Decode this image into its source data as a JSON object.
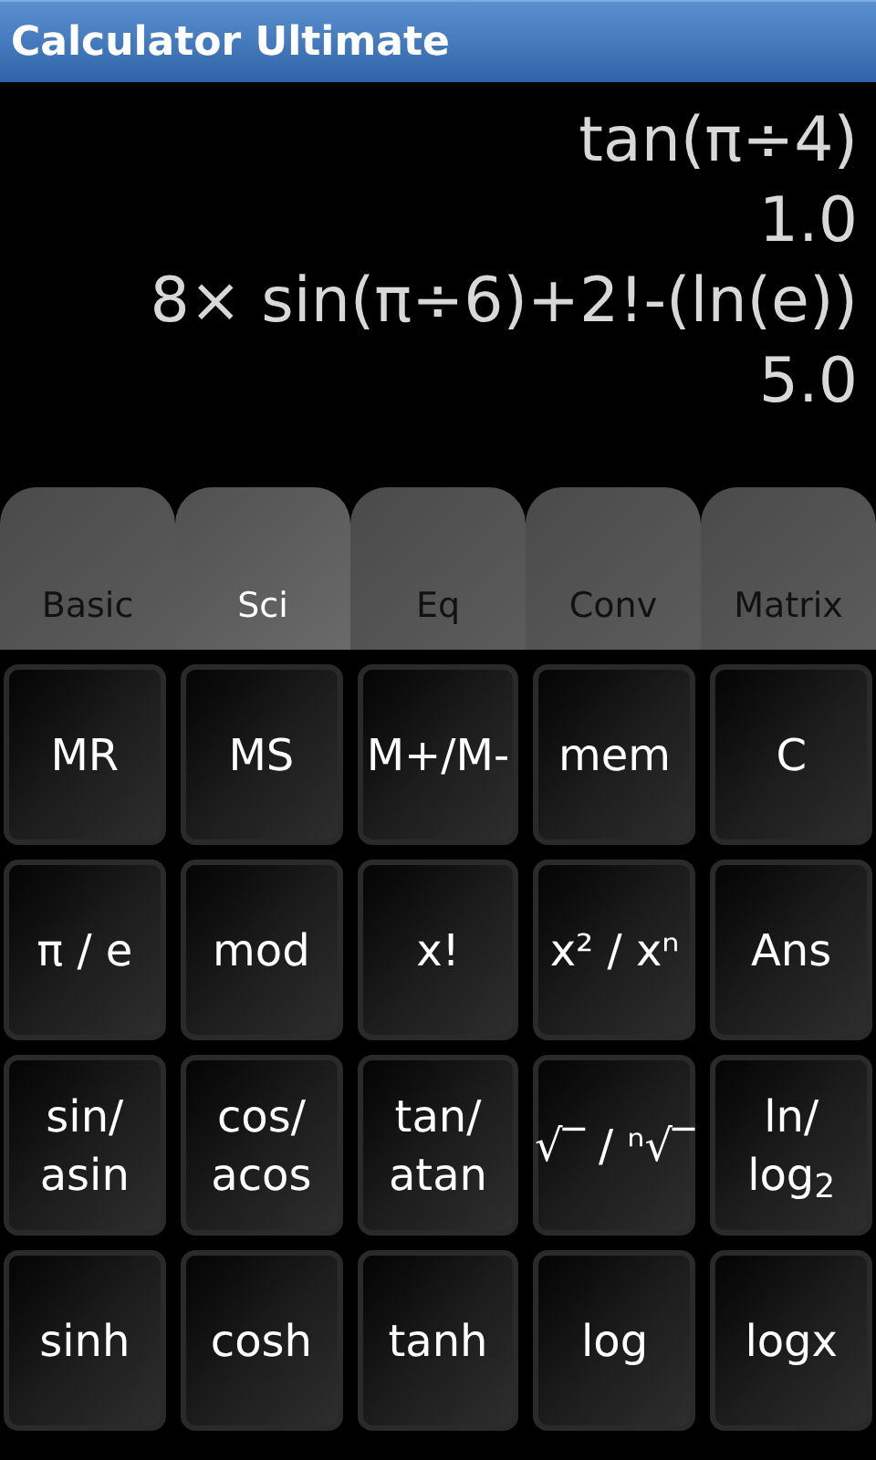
{
  "window": {
    "title": "Calculator Ultimate"
  },
  "display": {
    "lines": [
      "tan(π÷4)",
      "1.0",
      "8× sin(π÷6)+2!-(ln(e))",
      "5.0"
    ]
  },
  "tabs": [
    {
      "label": "Basic",
      "selected": false
    },
    {
      "label": "Sci",
      "selected": true
    },
    {
      "label": "Eq",
      "selected": false
    },
    {
      "label": "Conv",
      "selected": false
    },
    {
      "label": "Matrix",
      "selected": false
    }
  ],
  "keys": [
    {
      "lines": [
        "MR"
      ]
    },
    {
      "lines": [
        "MS"
      ]
    },
    {
      "lines": [
        "M+/M-"
      ]
    },
    {
      "lines": [
        "mem"
      ]
    },
    {
      "lines": [
        "C"
      ]
    },
    {
      "lines": [
        "π / e"
      ]
    },
    {
      "lines": [
        "mod"
      ]
    },
    {
      "lines": [
        "x!"
      ]
    },
    {
      "lines": [
        "x² / xⁿ"
      ]
    },
    {
      "lines": [
        "Ans"
      ]
    },
    {
      "lines": [
        "sin/",
        "asin"
      ]
    },
    {
      "lines": [
        "cos/",
        "acos"
      ]
    },
    {
      "lines": [
        "tan/",
        "atan"
      ]
    },
    {
      "lines": [
        "√‾ / ⁿ√‾"
      ]
    },
    {
      "lines": [
        "ln/",
        "log$_{2}$"
      ]
    },
    {
      "lines": [
        "sinh"
      ]
    },
    {
      "lines": [
        "cosh"
      ]
    },
    {
      "lines": [
        "tanh"
      ]
    },
    {
      "lines": [
        "log"
      ]
    },
    {
      "lines": [
        "logx"
      ]
    }
  ]
}
